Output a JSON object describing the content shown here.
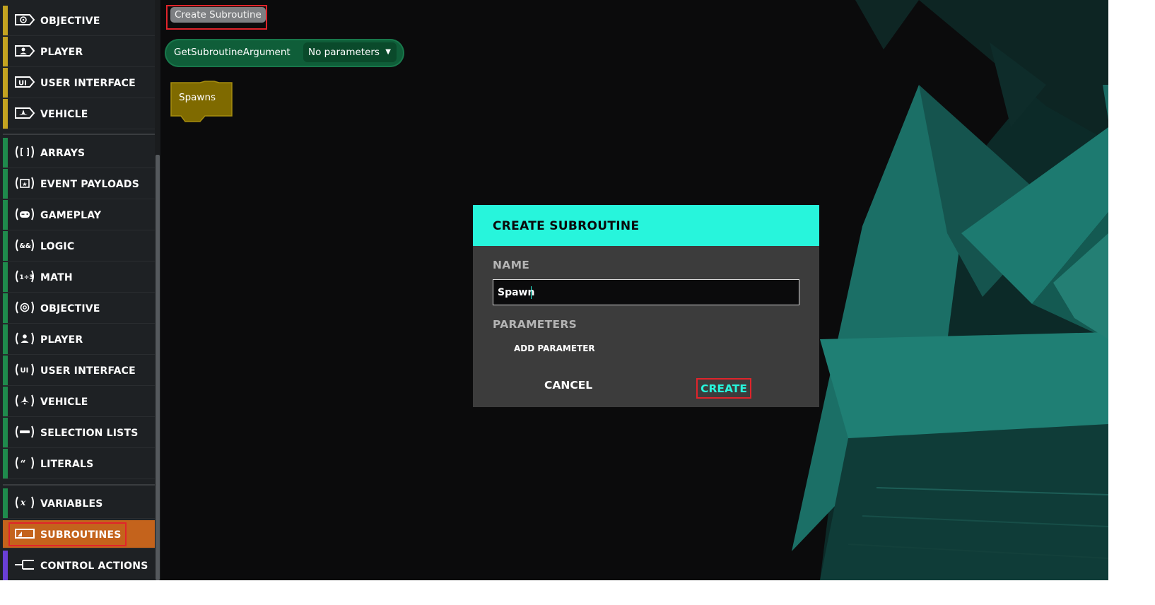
{
  "toolbar": {
    "create_subroutine_label": "Create Subroutine"
  },
  "sidebar": {
    "top_items": [
      {
        "label": "OBJECTIVE",
        "icon": "objective-icon",
        "color": "#c3a320"
      },
      {
        "label": "PLAYER",
        "icon": "player-icon",
        "color": "#c3a320"
      },
      {
        "label": "USER INTERFACE",
        "icon": "user-interface-icon",
        "color": "#c3a320"
      },
      {
        "label": "VEHICLE",
        "icon": "vehicle-icon",
        "color": "#c3a320"
      }
    ],
    "value_items": [
      {
        "label": "ARRAYS",
        "icon": "arrays-icon",
        "color": "#1f8a4c"
      },
      {
        "label": "EVENT PAYLOADS",
        "icon": "event-payloads-icon",
        "color": "#1f8a4c"
      },
      {
        "label": "GAMEPLAY",
        "icon": "gameplay-icon",
        "color": "#1f8a4c"
      },
      {
        "label": "LOGIC",
        "icon": "logic-icon",
        "color": "#1f8a4c"
      },
      {
        "label": "MATH",
        "icon": "math-icon",
        "color": "#1f8a4c"
      },
      {
        "label": "OBJECTIVE",
        "icon": "objective-icon",
        "color": "#1f8a4c"
      },
      {
        "label": "PLAYER",
        "icon": "player-icon",
        "color": "#1f8a4c"
      },
      {
        "label": "USER INTERFACE",
        "icon": "user-interface-icon",
        "color": "#1f8a4c"
      },
      {
        "label": "VEHICLE",
        "icon": "vehicle-icon",
        "color": "#1f8a4c"
      },
      {
        "label": "SELECTION LISTS",
        "icon": "selection-lists-icon",
        "color": "#1f8a4c"
      },
      {
        "label": "LITERALS",
        "icon": "literals-icon",
        "color": "#1f8a4c"
      }
    ],
    "bottom_items": [
      {
        "label": "VARIABLES",
        "icon": "variables-icon",
        "color": "#1f8a4c"
      },
      {
        "label": "SUBROUTINES",
        "icon": "subroutines-icon",
        "color": "#c4631c",
        "active": true
      },
      {
        "label": "CONTROL ACTIONS",
        "icon": "control-actions-icon",
        "color": "#6a3fd6"
      }
    ]
  },
  "workspace": {
    "get_argument_block": {
      "label": "GetSubroutineArgument",
      "dropdown_value": "No parameters"
    },
    "spawns_block": {
      "label": "Spawns"
    }
  },
  "modal": {
    "title": "CREATE SUBROUTINE",
    "name_label": "NAME",
    "name_value": "Spawn",
    "parameters_label": "PARAMETERS",
    "add_parameter_label": "ADD PARAMETER",
    "cancel_label": "CANCEL",
    "create_label": "CREATE"
  },
  "colors": {
    "accent": "#27f5dc",
    "highlight": "#e0242b",
    "active_category": "#c4631c"
  }
}
